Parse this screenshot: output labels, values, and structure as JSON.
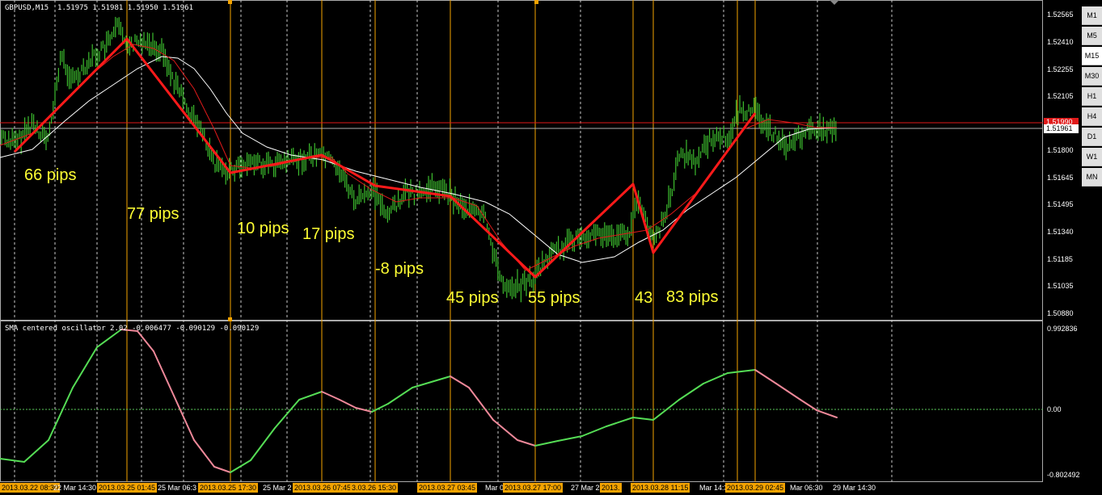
{
  "header": {
    "symbol_label": "GBPUSD,M15",
    "ohlc": "1.51975 1.51981 1.51950 1.51961"
  },
  "price_axis": {
    "ticks": [
      "1.52565",
      "1.52410",
      "1.52255",
      "1.52105",
      "1.51950",
      "1.51800",
      "1.51645",
      "1.51495",
      "1.51340",
      "1.51185",
      "1.51035",
      "1.50880"
    ],
    "current_price": "1.51961",
    "red_level_price": "1.51990"
  },
  "oscillator": {
    "label": "SMA centered oscillator 2.02 -0.006477 -0.090129 -0.090129",
    "max_label": "0.992836",
    "zero_label": "0.00",
    "min_label": "-0.802492"
  },
  "timeframes": [
    "M1",
    "M5",
    "M15",
    "M30",
    "H1",
    "H4",
    "D1",
    "W1",
    "MN"
  ],
  "active_timeframe": "M15",
  "time_axis": [
    {
      "text": "2013.03.22 08:30",
      "hl": true
    },
    {
      "text": "22 Mar 14:30",
      "hl": false
    },
    {
      "text": "2013.03.25 01:45",
      "hl": true
    },
    {
      "text": "25 Mar 06:3",
      "hl": false
    },
    {
      "text": "2013.03.25 17:30",
      "hl": true
    },
    {
      "text": "25 Mar 2",
      "hl": false
    },
    {
      "text": "2013.03.26 07:45",
      "hl": true
    },
    {
      "text": "3.03.26 15:30",
      "hl": true
    },
    {
      "text": "2013.03.27 03:45",
      "hl": true
    },
    {
      "text": "Mar 06:",
      "hl": false
    },
    {
      "text": "2013.03.27 17:00",
      "hl": true
    },
    {
      "text": "27 Mar 2",
      "hl": false
    },
    {
      "text": "2013.",
      "hl": true
    },
    {
      "text": "2013.03.28 11:15",
      "hl": true
    },
    {
      "text": "Mar 14:30",
      "hl": false
    },
    {
      "text": "2013.03.29 02:45",
      "hl": true
    },
    {
      "text": "Mar 06:30",
      "hl": false
    },
    {
      "text": "29 Mar 14:30",
      "hl": false
    }
  ],
  "pip_labels": [
    "66 pips",
    "77 pips",
    "10 pips",
    "17 pips",
    "-8 pips",
    "45 pips",
    "55 pips",
    "43",
    "83 pips"
  ],
  "colors": {
    "background": "#000000",
    "bars": "#3dbd2e",
    "zigzag": "#ff1a1a",
    "ma_white": "#ffffff",
    "ma_red": "#e01a1a",
    "pip_text": "#ffff33",
    "osc_up": "#55dd55",
    "osc_down": "#ee8899",
    "highlight_vlines": "#f3a300",
    "grid": "#cccccc"
  }
}
